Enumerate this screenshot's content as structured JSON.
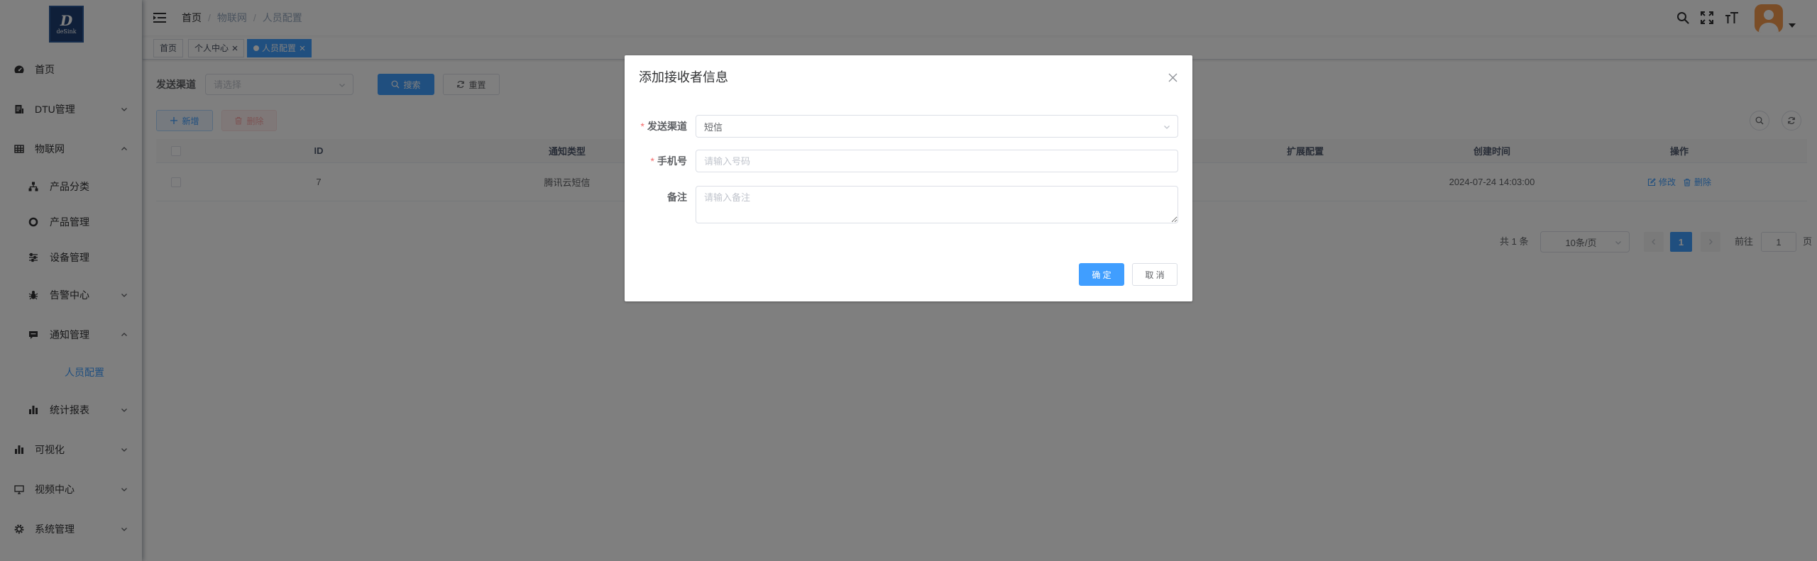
{
  "colors": {
    "accent": "#409eff",
    "danger": "#f56c6c",
    "logo_bg": "#1f3f72",
    "avatar_bg": "#f59a4f",
    "overlay": "rgba(0,0,0,0.5)"
  },
  "logo": {
    "letter": "D",
    "text": "deSink"
  },
  "sidebar": {
    "items": [
      {
        "label": "首页",
        "icon": "dashboard-icon"
      },
      {
        "label": "DTU管理",
        "icon": "document-icon",
        "expanded": false
      },
      {
        "label": "物联网",
        "icon": "table-icon",
        "expanded": true,
        "children": [
          {
            "label": "产品分类",
            "icon": "hierarchy-icon"
          },
          {
            "label": "产品管理",
            "icon": "lifebuoy-icon"
          },
          {
            "label": "设备管理",
            "icon": "sliders-icon"
          },
          {
            "label": "告警中心",
            "icon": "bug-icon",
            "expanded": false
          },
          {
            "label": "通知管理",
            "icon": "message-icon",
            "expanded": true,
            "children": [
              {
                "label": "人员配置",
                "active": true
              }
            ]
          },
          {
            "label": "统计报表",
            "icon": "bar-chart-icon",
            "expanded": false
          }
        ]
      },
      {
        "label": "可视化",
        "icon": "bar-chart-icon",
        "expanded": false
      },
      {
        "label": "视频中心",
        "icon": "monitor-icon",
        "expanded": false
      },
      {
        "label": "系统管理",
        "icon": "gear-icon",
        "expanded": false
      }
    ]
  },
  "navbar": {
    "breadcrumb": [
      "首页",
      "物联网",
      "人员配置"
    ],
    "separator": "/",
    "icons": [
      "hamburger-icon",
      "search-icon",
      "fullscreen-icon",
      "font-size-icon",
      "avatar",
      "caret-down-icon"
    ]
  },
  "tags": [
    {
      "label": "首页"
    },
    {
      "label": "个人中心",
      "closable": true
    },
    {
      "label": "人员配置",
      "closable": true,
      "active": true
    }
  ],
  "search_form": {
    "channel_label": "发送渠道",
    "channel_placeholder": "请选择",
    "search_button": "搜索",
    "reset_button": "重置"
  },
  "toolbar": {
    "add_button": "新增",
    "delete_button": "删除",
    "right_icons": [
      "search-icon",
      "refresh-icon"
    ]
  },
  "table": {
    "columns": [
      "ID",
      "通知类型",
      "扩展配置",
      "创建时间",
      "操作"
    ],
    "rows": [
      {
        "id": "7",
        "type": "腾讯云短信",
        "created": "2024-07-24 14:03:00",
        "actions": [
          "修改",
          "删除"
        ]
      }
    ]
  },
  "pagination": {
    "total": "共 1 条",
    "page_size": "10条/页",
    "current": "1",
    "goto_label": "前往",
    "goto_value": "1",
    "page_suffix": "页"
  },
  "dialog": {
    "title": "添加接收者信息",
    "required_mark": "*",
    "fields": {
      "channel": {
        "label": "发送渠道",
        "value": "短信",
        "required": true
      },
      "phone": {
        "label": "手机号",
        "placeholder": "请输入号码",
        "required": true
      },
      "remark": {
        "label": "备注",
        "placeholder": "请输入备注"
      }
    },
    "confirm": "确 定",
    "cancel": "取 消"
  }
}
